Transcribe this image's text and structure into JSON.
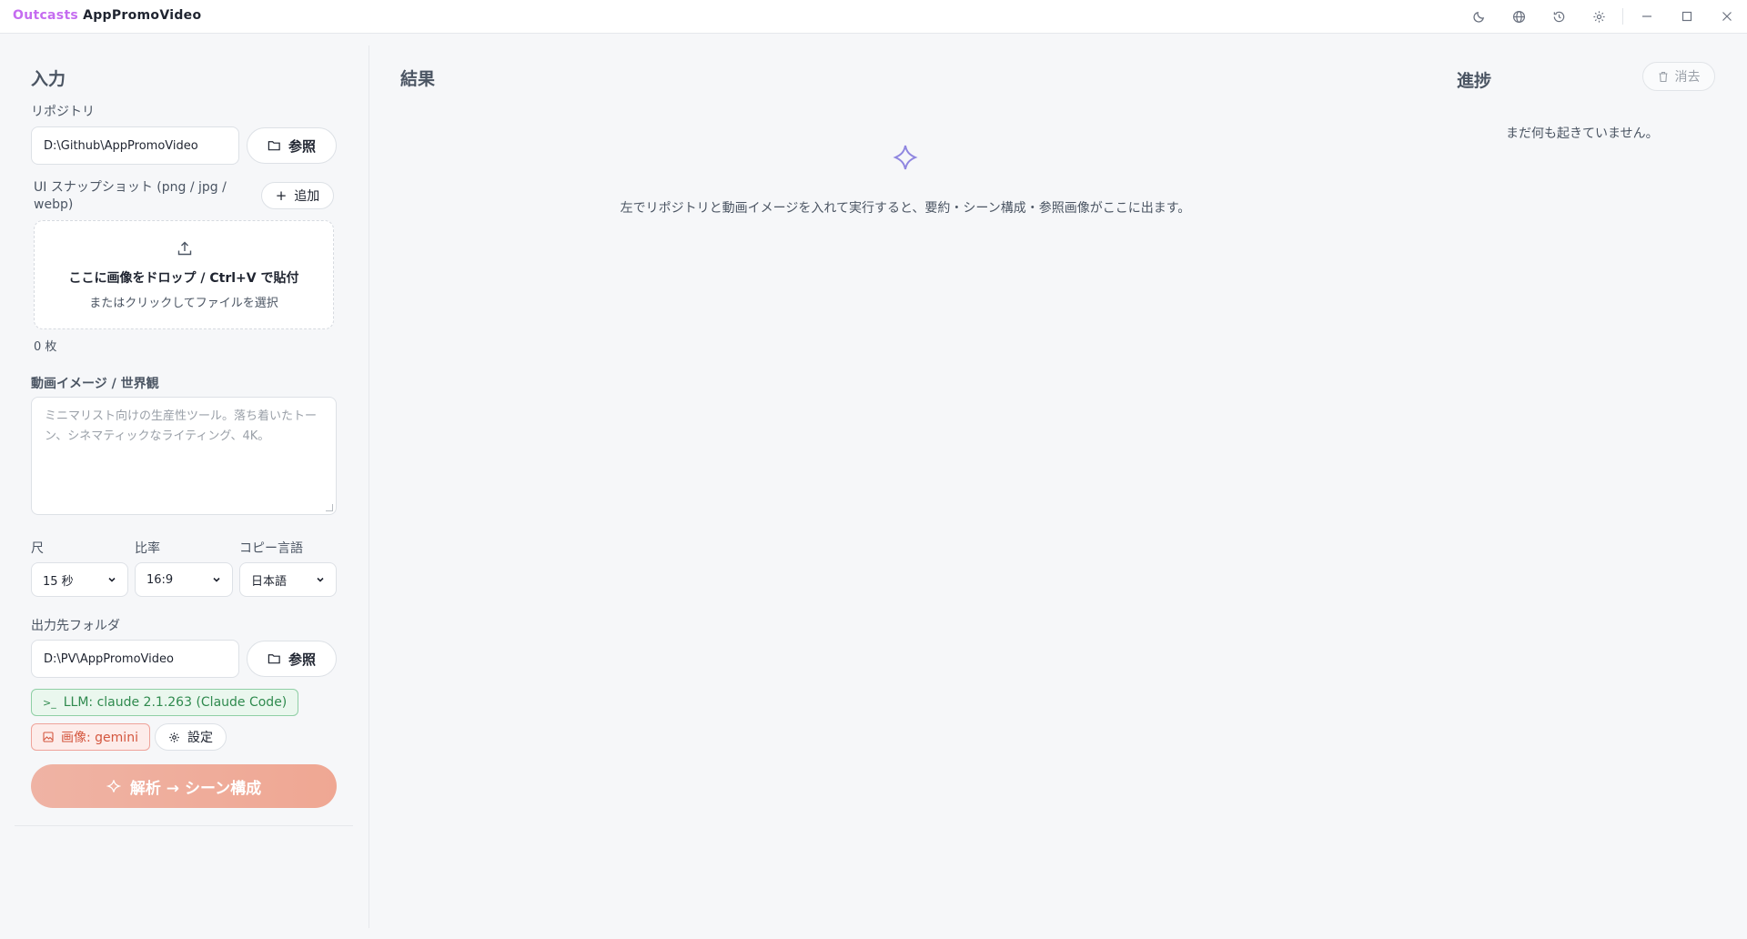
{
  "titlebar": {
    "brand_prefix": "Outcasts",
    "brand_name": "AppPromoVideo",
    "icons": [
      "moon-icon",
      "globe-icon",
      "history-icon",
      "gear-icon",
      "minimize-icon",
      "maximize-icon",
      "close-icon"
    ]
  },
  "input": {
    "title": "入力",
    "repo_label": "リポジトリ",
    "repo_value": "D:\\Github\\AppPromoVideo",
    "browse_label": "参照",
    "snapshot_label_line1": "UI スナップショット (png / jpg /",
    "snapshot_label_line2": "webp)",
    "add_label": "追加",
    "dropzone_main": "ここに画像をドロップ / Ctrl+V で貼付",
    "dropzone_sub": "またはクリックしてファイルを選択",
    "count": "0 枚",
    "vision_label": "動画イメージ / 世界観",
    "vision_placeholder": "ミニマリスト向けの生産性ツール。落ち着いたトーン、シネマティックなライティング、4K。",
    "length_label": "尺",
    "length_value": "15 秒",
    "ratio_label": "比率",
    "ratio_value": "16:9",
    "lang_label": "コピー言語",
    "lang_value": "日本語",
    "output_label": "出力先フォルダ",
    "output_value": "D:\\PV\\AppPromoVideo",
    "output_browse_label": "参照",
    "llm_badge": "LLM: claude 2.1.263 (Claude Code)",
    "image_badge": "画像: gemini",
    "settings_label": "設定",
    "run_label": "解析 → シーン構成"
  },
  "result": {
    "title": "結果",
    "empty_text": "左でリポジトリと動画イメージを入れて実行すると、要約・シーン構成・参照画像がここに出ます。"
  },
  "progress": {
    "title": "進捗",
    "clear_label": "消去",
    "empty_text": "まだ何も起きていません。"
  },
  "colors": {
    "brand_accent": "#c56cf0",
    "run_button": "#efa793",
    "llm_badge": "#2f8a4e",
    "image_badge": "#d4573f"
  }
}
